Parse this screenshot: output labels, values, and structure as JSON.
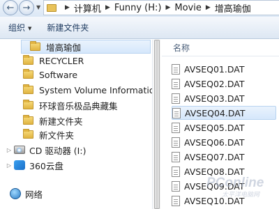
{
  "address_bar": {
    "crumbs": [
      "计算机",
      "Funny (H:)",
      "Movie",
      "增高瑜伽"
    ]
  },
  "toolbar": {
    "organize_label": "组织",
    "new_folder_label": "新建文件夹"
  },
  "nav": {
    "items": [
      {
        "label": "增高瑜伽",
        "type": "folder"
      },
      {
        "label": "RECYCLER",
        "type": "folder"
      },
      {
        "label": "Software",
        "type": "folder"
      },
      {
        "label": "System Volume Information",
        "type": "folder"
      },
      {
        "label": "环球音乐极品典藏集",
        "type": "folder"
      },
      {
        "label": "新建文件夹",
        "type": "folder"
      },
      {
        "label": "新文件夹",
        "type": "folder"
      },
      {
        "label": "CD 驱动器 (I:)",
        "type": "drive"
      },
      {
        "label": "360云盘",
        "type": "cloud"
      },
      {
        "label": "网络",
        "type": "network"
      }
    ]
  },
  "files": {
    "column_name": "名称",
    "items": [
      "AVSEQ01.DAT",
      "AVSEQ02.DAT",
      "AVSEQ03.DAT",
      "AVSEQ04.DAT",
      "AVSEQ05.DAT",
      "AVSEQ06.DAT",
      "AVSEQ07.DAT",
      "AVSEQ08.DAT",
      "AVSEQ09.DAT",
      "AVSEQ10.DAT"
    ],
    "selected_index": 3
  },
  "watermark": {
    "brand": "PConline",
    "tagline": "太平洋电脑网"
  }
}
